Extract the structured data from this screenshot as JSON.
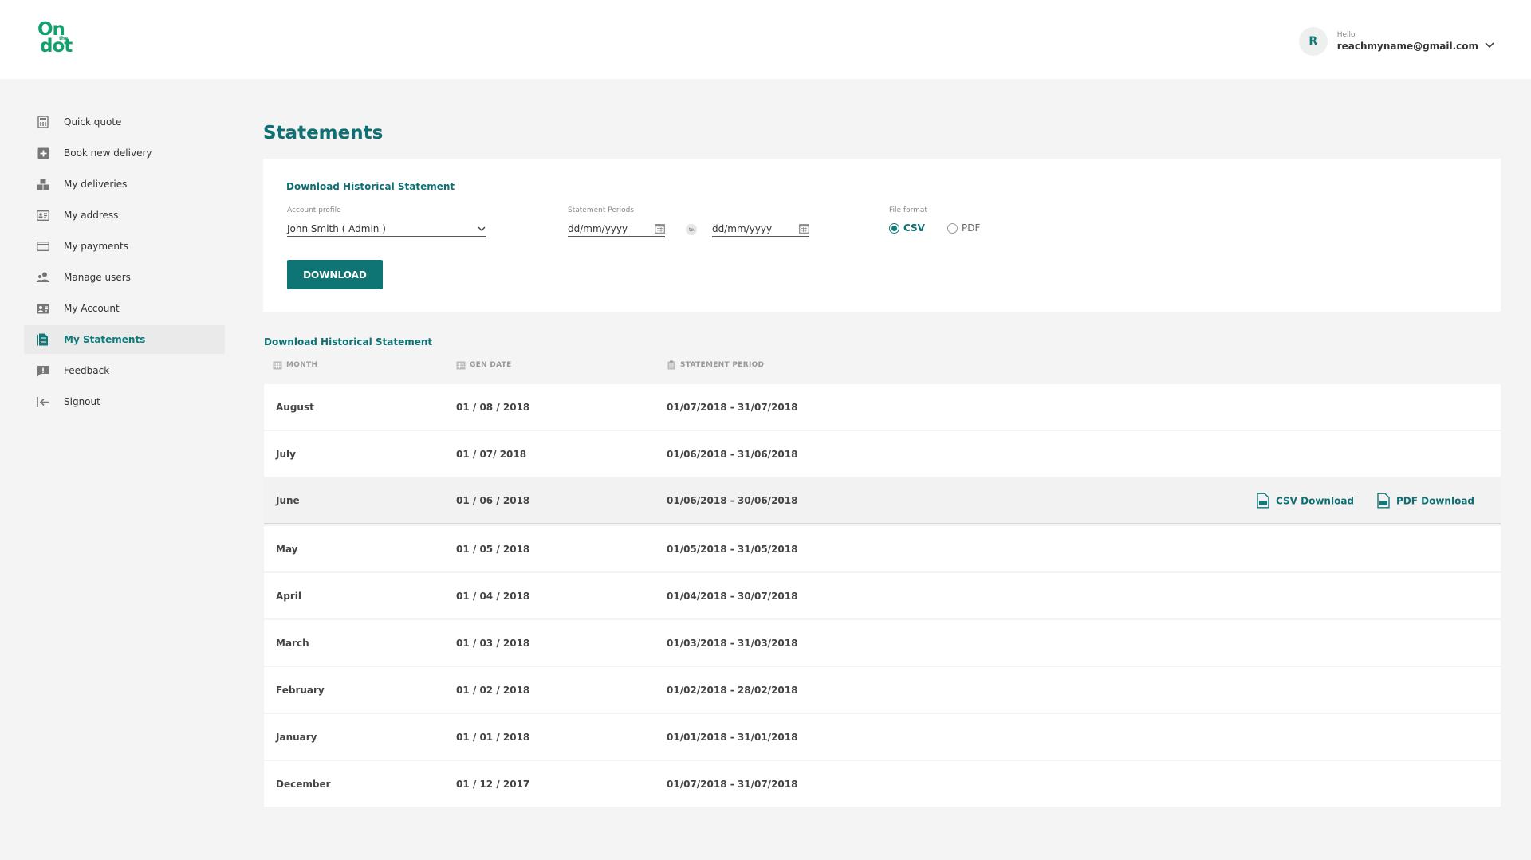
{
  "header": {
    "logo": {
      "line1": "On",
      "line2": "the",
      "line3": "dot"
    },
    "user": {
      "initial": "R",
      "greeting": "Hello",
      "email": "reachmyname@gmail.com"
    }
  },
  "sidebar": {
    "items": [
      {
        "label": "Quick quote",
        "icon": "calculator-icon"
      },
      {
        "label": "Book new delivery",
        "icon": "plus-box-icon"
      },
      {
        "label": "My deliveries",
        "icon": "boxes-icon"
      },
      {
        "label": "My address",
        "icon": "address-card-icon"
      },
      {
        "label": "My payments",
        "icon": "credit-card-icon"
      },
      {
        "label": "Manage users",
        "icon": "users-icon"
      },
      {
        "label": "My Account",
        "icon": "id-card-icon"
      },
      {
        "label": "My Statements",
        "icon": "document-icon",
        "active": true
      },
      {
        "label": "Feedback",
        "icon": "feedback-icon"
      },
      {
        "label": "Signout",
        "icon": "signout-icon"
      }
    ]
  },
  "main": {
    "title": "Statements",
    "form": {
      "title": "Download Historical Statement",
      "account_label": "Account profile",
      "account_value": "John Smith ( Admin )",
      "period_label": "Statement Periods",
      "date_from_placeholder": "dd/mm/yyyy",
      "to_label": "to",
      "date_to_placeholder": "dd/mm/yyyy",
      "format_label": "File format",
      "format_csv": "CSV",
      "format_pdf": "PDF",
      "selected_format": "CSV",
      "download_label": "DOWNLOAD"
    },
    "list": {
      "title": "Download Historical Statement",
      "columns": {
        "month": "MONTH",
        "gen_date": "GEN DATE",
        "period": "STATEMENT PERIOD"
      },
      "rows": [
        {
          "month": "August",
          "gen": "01 / 08 / 2018",
          "period": "01/07/2018  -  31/07/2018"
        },
        {
          "month": "July",
          "gen": "01 / 07/ 2018",
          "period": "01/06/2018  -  31/06/2018"
        },
        {
          "month": "June",
          "gen": "01 / 06 / 2018",
          "period": "01/06/2018  -  30/06/2018"
        },
        {
          "month": "May",
          "gen": "01 / 05 / 2018",
          "period": "01/05/2018  -  31/05/2018"
        },
        {
          "month": "April",
          "gen": "01 / 04 / 2018",
          "period": "01/04/2018  -  30/07/2018"
        },
        {
          "month": "March",
          "gen": "01 / 03 / 2018",
          "period": "01/03/2018  -  31/03/2018"
        },
        {
          "month": "February",
          "gen": "01 / 02 / 2018",
          "period": "01/02/2018  -  28/02/2018"
        },
        {
          "month": "January",
          "gen": "01 / 01 / 2018",
          "period": "01/01/2018  -  31/01/2018"
        },
        {
          "month": "December",
          "gen": "01 / 12 / 2017",
          "period": "01/07/2018  -  31/07/2018"
        }
      ],
      "row_actions": {
        "csv": "CSV Download",
        "pdf": "PDF Download"
      }
    }
  },
  "colors": {
    "brand_green": "#12a06d",
    "teal": "#0f6f73",
    "button": "#0e7474"
  }
}
